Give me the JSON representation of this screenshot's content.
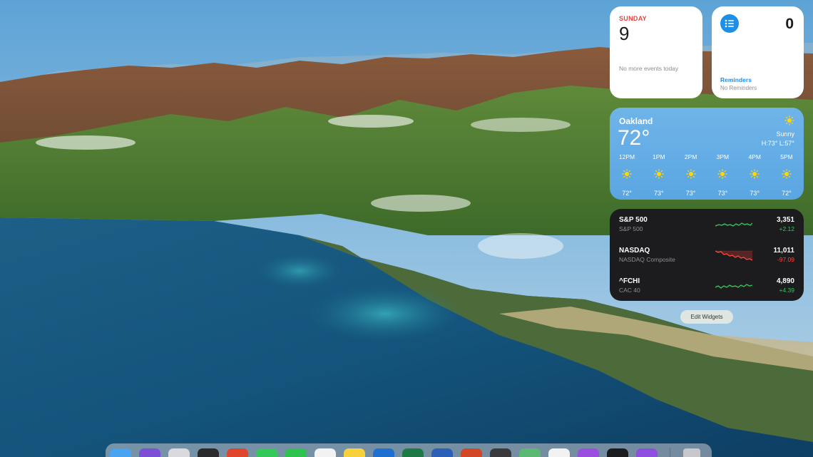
{
  "calendar": {
    "day": "SUNDAY",
    "date": "9",
    "note": "No more events today"
  },
  "reminders": {
    "count": "0",
    "title": "Reminders",
    "subtitle": "No Reminders",
    "icon": "list-icon"
  },
  "weather": {
    "city": "Oakland",
    "temperature": "72°",
    "condition": "Sunny",
    "high_low": "H:73° L:57°",
    "hours": [
      {
        "time": "12PM",
        "temp": "72°"
      },
      {
        "time": "1PM",
        "temp": "73°"
      },
      {
        "time": "2PM",
        "temp": "73°"
      },
      {
        "time": "3PM",
        "temp": "73°"
      },
      {
        "time": "4PM",
        "temp": "73°"
      },
      {
        "time": "5PM",
        "temp": "72°"
      }
    ]
  },
  "stocks": [
    {
      "symbol": "S&P 500",
      "name": "S&P 500",
      "price": "3,351",
      "change": "+2.12",
      "trend": "up",
      "color": "#34c759"
    },
    {
      "symbol": "NASDAQ",
      "name": "NASDAQ Composite",
      "price": "11,011",
      "change": "-97.09",
      "trend": "down",
      "color": "#ff453a"
    },
    {
      "symbol": "^FCHI",
      "name": "CAC 40",
      "price": "4,890",
      "change": "+4.39",
      "trend": "up",
      "color": "#34c759"
    }
  ],
  "edit_widgets_label": "Edit Widgets",
  "dock": {
    "apps": [
      {
        "name": "finder-icon",
        "color": "#4aa3f0"
      },
      {
        "name": "siri-icon",
        "color": "#7b4fd6"
      },
      {
        "name": "launchpad-icon",
        "color": "#d9d9de"
      },
      {
        "name": "app-icon",
        "color": "#2b2b2b"
      },
      {
        "name": "chrome-icon",
        "color": "#e0452d"
      },
      {
        "name": "messages-icon",
        "color": "#34c759"
      },
      {
        "name": "facetime-icon",
        "color": "#2ec24f"
      },
      {
        "name": "slack-icon",
        "color": "#f2f2f2"
      },
      {
        "name": "notes-icon",
        "color": "#f7d13c"
      },
      {
        "name": "outlook-icon",
        "color": "#1f6fd1"
      },
      {
        "name": "excel-icon",
        "color": "#1d7a45"
      },
      {
        "name": "word-icon",
        "color": "#2b5fb8"
      },
      {
        "name": "powerpoint-icon",
        "color": "#d24726"
      },
      {
        "name": "activity-monitor-icon",
        "color": "#3a3a3c"
      },
      {
        "name": "maps-icon",
        "color": "#5bb974"
      },
      {
        "name": "photos-icon",
        "color": "#f2f2f2"
      },
      {
        "name": "podcasts-icon",
        "color": "#9b4fe0"
      },
      {
        "name": "terminal-icon",
        "color": "#1c1c1e"
      },
      {
        "name": "app-store-icon",
        "color": "#8e4fe0"
      },
      {
        "name": "trash-icon",
        "color": "#c8c8cc"
      }
    ]
  }
}
